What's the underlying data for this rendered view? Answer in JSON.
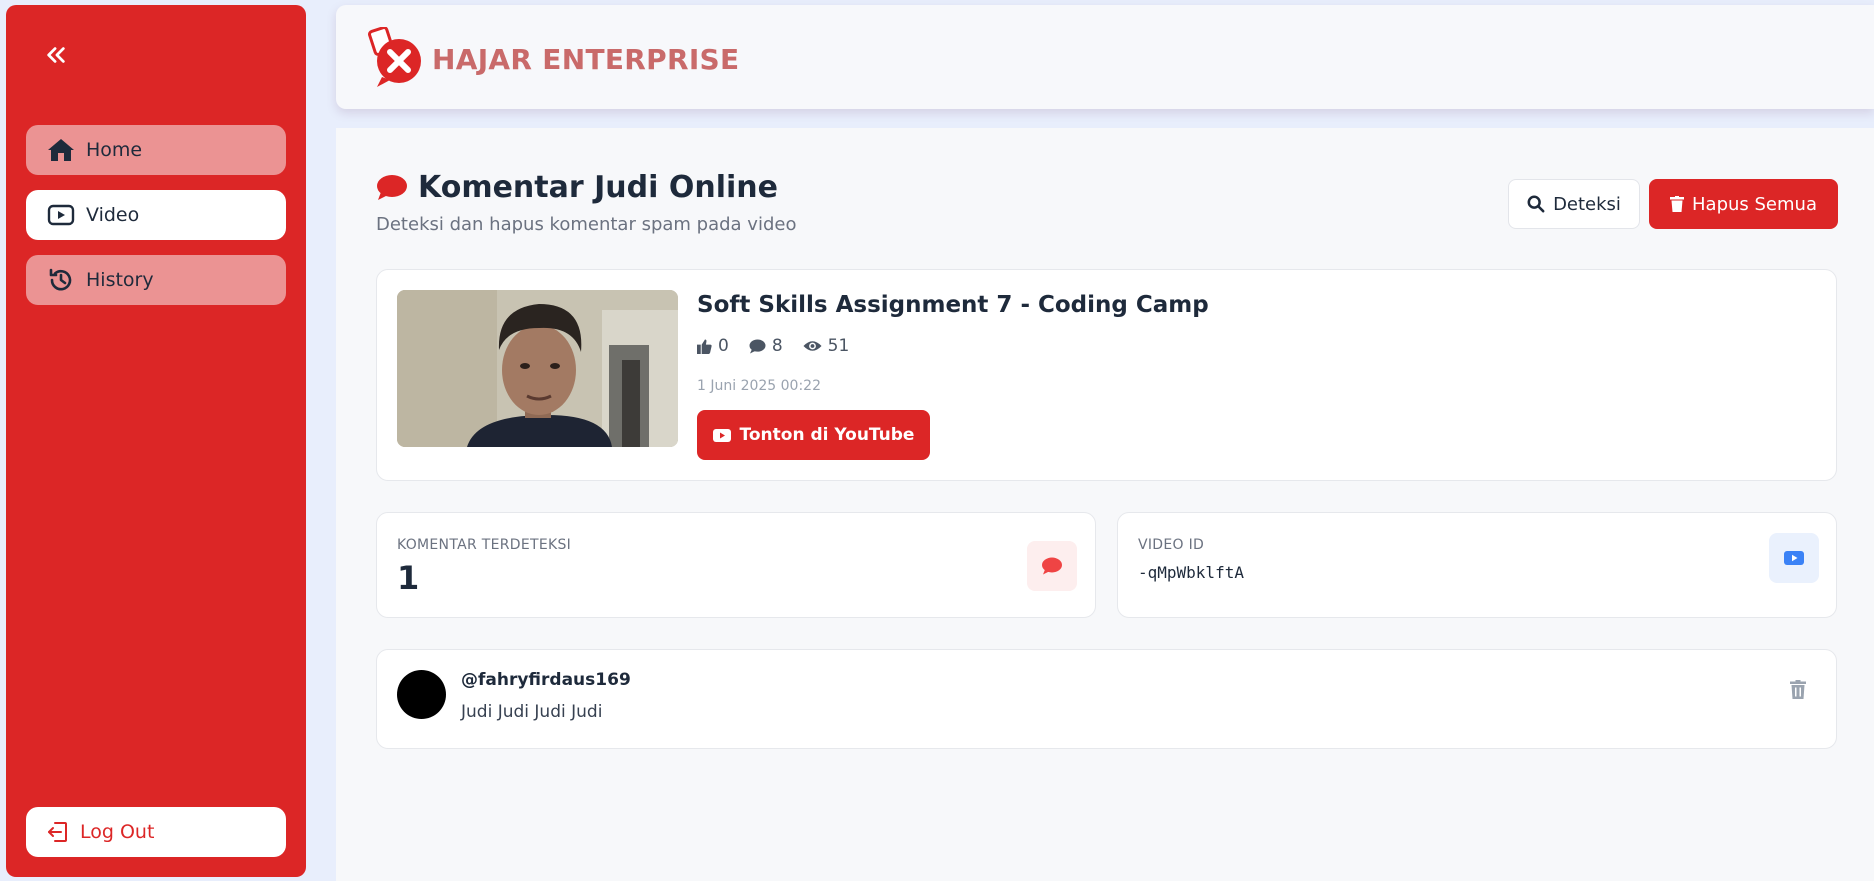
{
  "brand": {
    "name": "HAJAR ENTERPRISE"
  },
  "sidebar": {
    "items": [
      {
        "label": "Home",
        "icon": "home-icon"
      },
      {
        "label": "Video",
        "icon": "video-icon"
      },
      {
        "label": "History",
        "icon": "history-icon"
      }
    ],
    "logout_label": "Log Out"
  },
  "page": {
    "title": "Komentar Judi Online",
    "subtitle": "Deteksi dan hapus komentar spam pada video",
    "deteksi_label": "Deteksi",
    "hapus_semua_label": "Hapus Semua"
  },
  "video": {
    "title": "Soft Skills Assignment 7 - Coding Camp",
    "likes": "0",
    "comments": "8",
    "views": "51",
    "date": "1 Juni 2025 00:22",
    "youtube_label": "Tonton di YouTube"
  },
  "stats": {
    "detected_label": "KOMENTAR TERDETEKSI",
    "detected_value": "1",
    "video_id_label": "VIDEO ID",
    "video_id_value": "-qMpWbklftA"
  },
  "comments": [
    {
      "author": "@fahryfirdaus169",
      "text": "Judi Judi Judi Judi"
    }
  ],
  "colors": {
    "accent": "#dc2626",
    "nav_tint": "#eb9393",
    "brand_text": "#c96a6a"
  }
}
